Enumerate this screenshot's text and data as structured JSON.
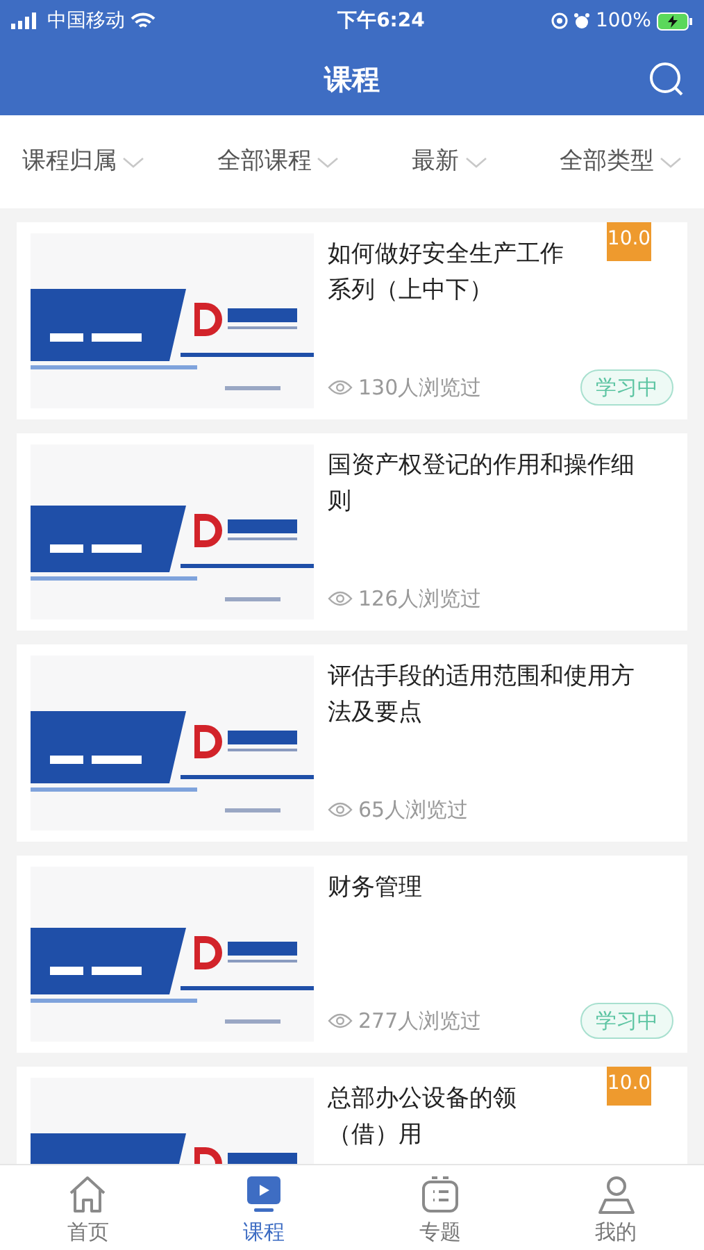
{
  "status_bar": {
    "carrier": "中国移动",
    "time": "下午6:24",
    "battery": "100%"
  },
  "header": {
    "title": "课程"
  },
  "filters": [
    {
      "label": "课程归属"
    },
    {
      "label": "全部课程"
    },
    {
      "label": "最新"
    },
    {
      "label": "全部类型"
    }
  ],
  "courses": [
    {
      "title": "如何做好安全生产工作系列（上中下）",
      "views": "130人浏览过",
      "score": "10.0",
      "tag": "学习中"
    },
    {
      "title": "国资产权登记的作用和操作细则",
      "views": "126人浏览过"
    },
    {
      "title": "评估手段的适用范围和使用方法及要点",
      "views": "65人浏览过"
    },
    {
      "title": "财务管理",
      "views": "277人浏览过",
      "tag": "学习中"
    },
    {
      "title": "总部办公设备的领（借）用",
      "score": "10.0"
    }
  ],
  "tab_bar": [
    {
      "label": "首页",
      "selected": false
    },
    {
      "label": "课程",
      "selected": true
    },
    {
      "label": "专题",
      "selected": false
    },
    {
      "label": "我的",
      "selected": false
    }
  ]
}
